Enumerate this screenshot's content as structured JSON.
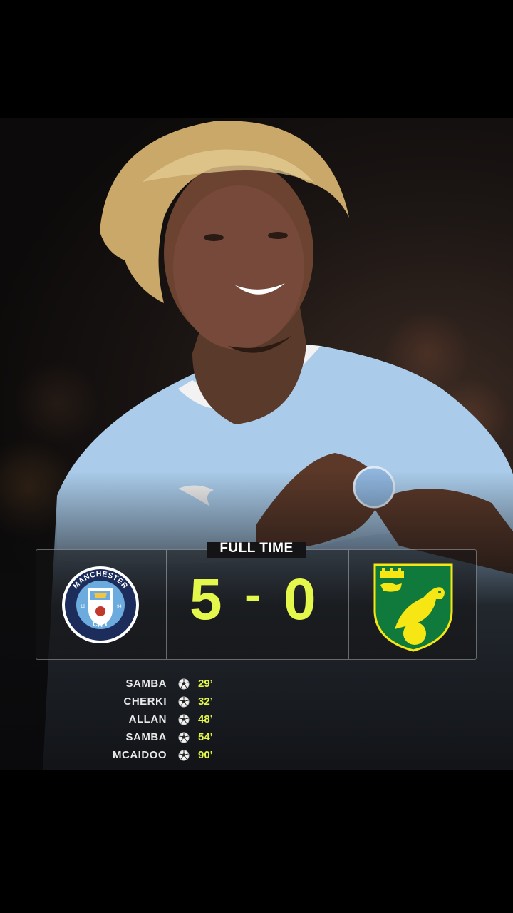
{
  "header": {
    "label": "FULL TIME"
  },
  "home_team": {
    "name": "Manchester City",
    "crest_top_text": "MANCHESTER",
    "crest_bottom_text": "CITY",
    "crest_years_left": "18",
    "crest_years_right": "94",
    "score": "5"
  },
  "score_separator": "-",
  "away_team": {
    "name": "Norwich City",
    "score": "0"
  },
  "colors": {
    "accent": "#e4f74b",
    "city_blue": "#a9cbea",
    "norwich_yellow": "#f5e614",
    "norwich_green": "#0f7a3c"
  },
  "scorers": [
    {
      "name": "SAMBA",
      "minute": "29’",
      "icon": "football-icon"
    },
    {
      "name": "CHERKI",
      "minute": "32’",
      "icon": "football-icon"
    },
    {
      "name": "ALLAN",
      "minute": "48’",
      "icon": "football-icon"
    },
    {
      "name": "SAMBA",
      "minute": "54’",
      "icon": "football-icon"
    },
    {
      "name": "MCAIDOO",
      "minute": "90’",
      "icon": "football-icon"
    }
  ]
}
